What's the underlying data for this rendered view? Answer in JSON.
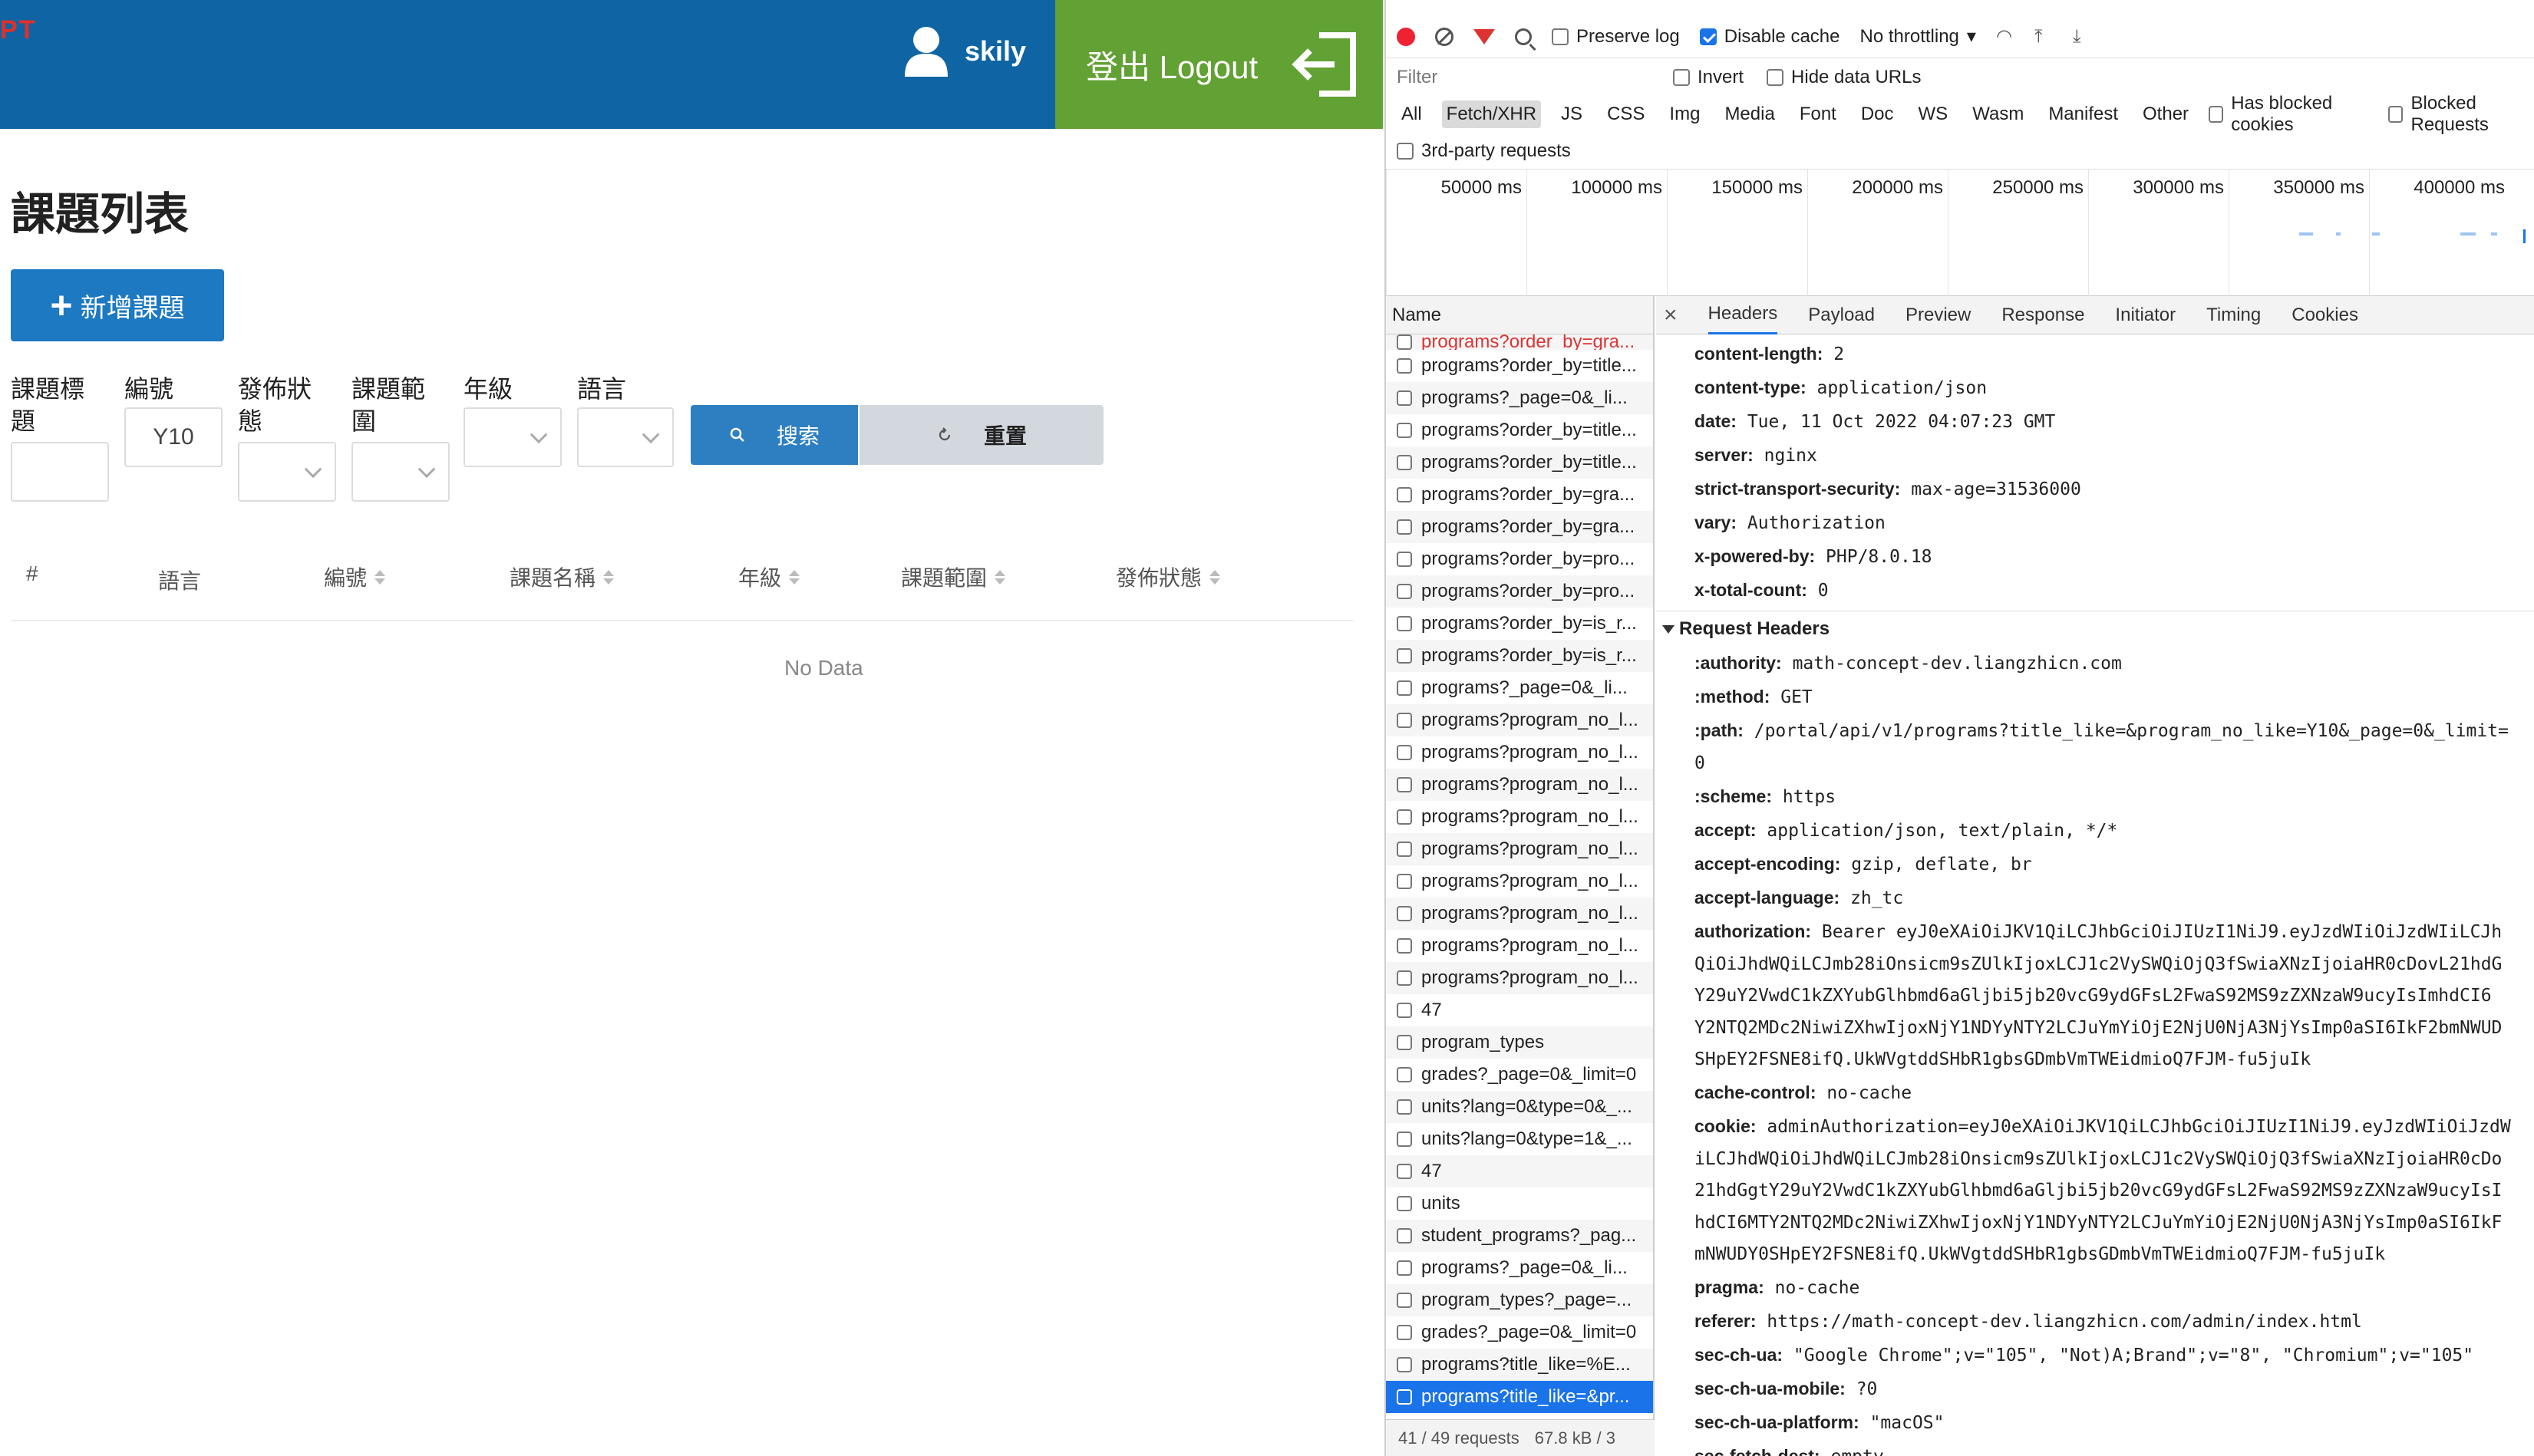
{
  "app": {
    "brand": "PT",
    "user_name": "skily",
    "logout_label": "登出 Logout",
    "page_title": "課題列表",
    "add_button": "新增課題",
    "filters": {
      "title_label": "課題標題",
      "number_label": "編號",
      "number_value": "Y10",
      "status_label": "發佈狀態",
      "scope_label": "課題範圍",
      "grade_label": "年級",
      "language_label": "語言"
    },
    "search_button": "搜索",
    "reset_button": "重置",
    "table": {
      "columns": [
        "#",
        "語言",
        "編號",
        "課題名稱",
        "年級",
        "課題範圍",
        "發佈狀態"
      ],
      "empty_text": "No Data"
    }
  },
  "devtools": {
    "toolbar": {
      "preserve_log": "Preserve log",
      "disable_cache": "Disable cache",
      "throttling": "No throttling"
    },
    "filter": {
      "placeholder": "Filter",
      "invert": "Invert",
      "hide_data_urls": "Hide data URLs"
    },
    "types": [
      "All",
      "Fetch/XHR",
      "JS",
      "CSS",
      "Img",
      "Media",
      "Font",
      "Doc",
      "WS",
      "Wasm",
      "Manifest",
      "Other"
    ],
    "active_type": "Fetch/XHR",
    "has_blocked_cookies": "Has blocked cookies",
    "blocked_requests": "Blocked Requests",
    "third_party": "3rd-party requests",
    "timeline_ticks": [
      "50000 ms",
      "100000 ms",
      "150000 ms",
      "200000 ms",
      "250000 ms",
      "300000 ms",
      "350000 ms",
      "400000 ms"
    ],
    "name_header": "Name",
    "requests": [
      "programs?order_by=gra...",
      "programs?order_by=title...",
      "programs?_page=0&_li...",
      "programs?order_by=title...",
      "programs?order_by=title...",
      "programs?order_by=gra...",
      "programs?order_by=gra...",
      "programs?order_by=pro...",
      "programs?order_by=pro...",
      "programs?order_by=is_r...",
      "programs?order_by=is_r...",
      "programs?_page=0&_li...",
      "programs?program_no_l...",
      "programs?program_no_l...",
      "programs?program_no_l...",
      "programs?program_no_l...",
      "programs?program_no_l...",
      "programs?program_no_l...",
      "programs?program_no_l...",
      "programs?program_no_l...",
      "programs?program_no_l...",
      "47",
      "program_types",
      "grades?_page=0&_limit=0",
      "units?lang=0&type=0&_...",
      "units?lang=0&type=1&_...",
      "47",
      "units",
      "student_programs?_pag...",
      "programs?_page=0&_li...",
      "program_types?_page=...",
      "grades?_page=0&_limit=0",
      "programs?title_like=%E...",
      "programs?title_like=&pr..."
    ],
    "footer_requests": "41 / 49 requests",
    "footer_size": "67.8 kB / 3",
    "tabs": [
      "Headers",
      "Payload",
      "Preview",
      "Response",
      "Initiator",
      "Timing",
      "Cookies"
    ],
    "active_tab": "Headers",
    "response_headers": [
      {
        "k": "content-length:",
        "v": "2"
      },
      {
        "k": "content-type:",
        "v": "application/json"
      },
      {
        "k": "date:",
        "v": "Tue, 11 Oct 2022 04:07:23 GMT"
      },
      {
        "k": "server:",
        "v": "nginx"
      },
      {
        "k": "strict-transport-security:",
        "v": "max-age=31536000"
      },
      {
        "k": "vary:",
        "v": "Authorization"
      },
      {
        "k": "x-powered-by:",
        "v": "PHP/8.0.18"
      },
      {
        "k": "x-total-count:",
        "v": "0"
      }
    ],
    "request_headers_title": "Request Headers",
    "request_headers": [
      {
        "k": ":authority:",
        "v": "math-concept-dev.liangzhicn.com"
      },
      {
        "k": ":method:",
        "v": "GET"
      },
      {
        "k": ":path:",
        "v": "/portal/api/v1/programs?title_like=&program_no_like=Y10&_page=0&_limit="
      },
      {
        "k": "",
        "v": "0"
      },
      {
        "k": ":scheme:",
        "v": "https"
      },
      {
        "k": "accept:",
        "v": "application/json, text/plain, */*"
      },
      {
        "k": "accept-encoding:",
        "v": "gzip, deflate, br"
      },
      {
        "k": "accept-language:",
        "v": "zh_tc"
      },
      {
        "k": "authorization:",
        "v": "Bearer eyJ0eXAiOiJKV1QiLCJhbGciOiJIUzI1NiJ9.eyJzdWIiOiJzdWIiLCJh"
      },
      {
        "k": "",
        "v": "QiOiJhdWQiLCJmb28iOnsicm9sZUlkIjoxLCJ1c2VySWQiOjQ3fSwiaXNzIjoiaHR0cDovL21hdG"
      },
      {
        "k": "",
        "v": "Y29uY2VwdC1kZXYubGlhbmd6aGljbi5jb20vcG9ydGFsL2FwaS92MS9zZXNzaW9ucyIsImhdCI6"
      },
      {
        "k": "",
        "v": "Y2NTQ2MDc2NiwiZXhwIjoxNjY1NDYyNTY2LCJuYmYiOjE2NjU0NjA3NjYsImp0aSI6IkF2bmNWUD"
      },
      {
        "k": "",
        "v": "SHpEY2FSNE8ifQ.UkWVgtddSHbR1gbsGDmbVmTWEidmioQ7FJM-fu5juIk"
      },
      {
        "k": "cache-control:",
        "v": "no-cache"
      },
      {
        "k": "cookie:",
        "v": "adminAuthorization=eyJ0eXAiOiJKV1QiLCJhbGciOiJIUzI1NiJ9.eyJzdWIiOiJzdW"
      },
      {
        "k": "",
        "v": "iLCJhdWQiOiJhdWQiLCJmb28iOnsicm9sZUlkIjoxLCJ1c2VySWQiOjQ3fSwiaXNzIjoiaHR0cDo"
      },
      {
        "k": "",
        "v": "21hdGgtY29uY2VwdC1kZXYubGlhbmd6aGljbi5jb20vcG9ydGFsL2FwaS92MS9zZXNzaW9ucyIsI"
      },
      {
        "k": "",
        "v": "hdCI6MTY2NTQ2MDc2NiwiZXhwIjoxNjY1NDYyNTY2LCJuYmYiOjE2NjU0NjA3NjYsImp0aSI6IkF"
      },
      {
        "k": "",
        "v": "mNWUDY0SHpEY2FSNE8ifQ.UkWVgtddSHbR1gbsGDmbVmTWEidmioQ7FJM-fu5juIk"
      },
      {
        "k": "pragma:",
        "v": "no-cache"
      },
      {
        "k": "referer:",
        "v": "https://math-concept-dev.liangzhicn.com/admin/index.html"
      },
      {
        "k": "sec-ch-ua:",
        "v": "\"Google Chrome\";v=\"105\", \"Not)A;Brand\";v=\"8\", \"Chromium\";v=\"105\""
      },
      {
        "k": "sec-ch-ua-mobile:",
        "v": "?0"
      },
      {
        "k": "sec-ch-ua-platform:",
        "v": "\"macOS\""
      },
      {
        "k": "sec-fetch-dest:",
        "v": "empty"
      }
    ],
    "colors": {
      "accent": "#1a73e8",
      "topbar": "#0f65a4",
      "logout": "#62a133",
      "record": "#ee2233"
    }
  }
}
